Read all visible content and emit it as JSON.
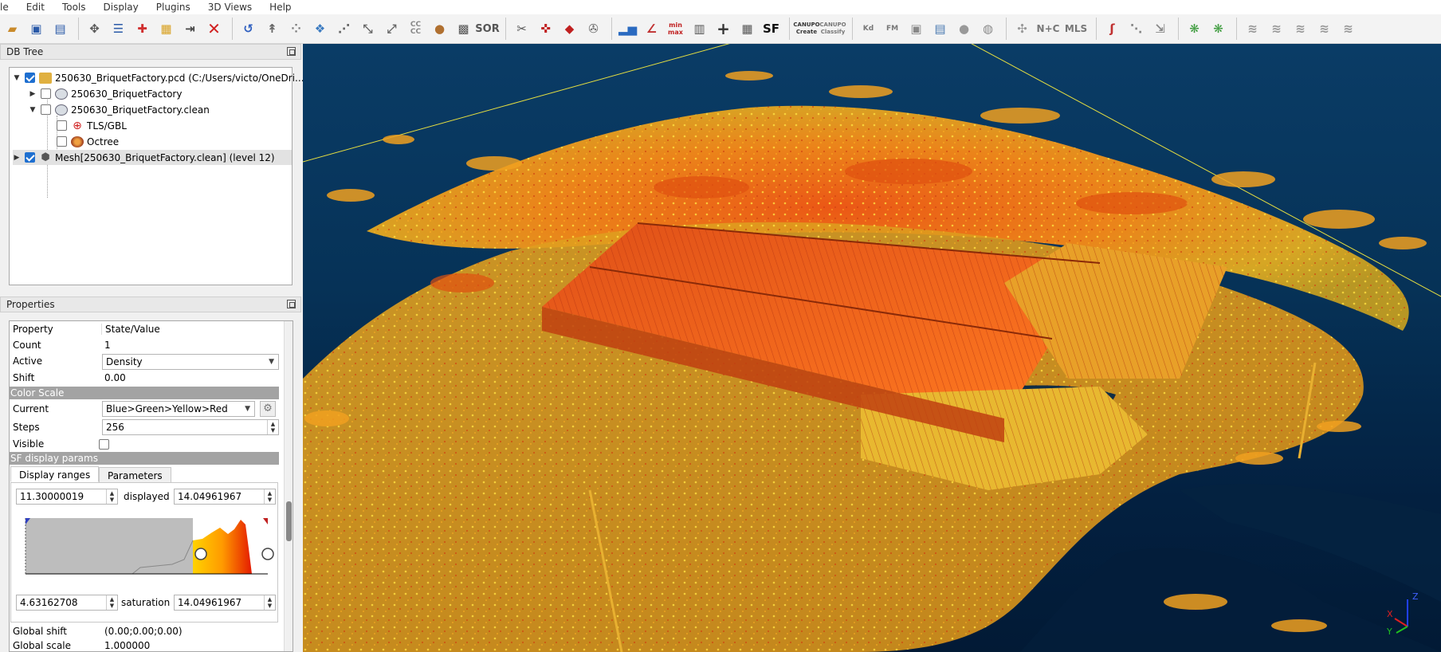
{
  "menu": [
    "le",
    "Edit",
    "Tools",
    "Display",
    "Plugins",
    "3D Views",
    "Help"
  ],
  "toolbar": {
    "sor_label": "SOR",
    "cc_label": "CC\nCC",
    "sf_label": "SF",
    "canupo_create": "CANUPO\nCreate",
    "canupo_classify": "CANUPO\nClassify",
    "kd_label": "Kd",
    "fm_label": "FM",
    "nc_label": "N+C",
    "mls_label": "MLS",
    "mm_label": "min\nmax"
  },
  "dbtree": {
    "title": "DB Tree",
    "items": [
      {
        "label": "250630_BriquetFactory.pcd (C:/Users/victo/OneDri...",
        "checked": true,
        "icon": "folder-icon"
      },
      {
        "label": "250630_BriquetFactory",
        "checked": false,
        "icon": "cloud-icon"
      },
      {
        "label": "250630_BriquetFactory.clean",
        "checked": false,
        "icon": "cloud-icon"
      },
      {
        "label": "TLS/GBL",
        "checked": false,
        "icon": "sensor-icon"
      },
      {
        "label": "Octree",
        "checked": false,
        "icon": "octree-icon"
      },
      {
        "label": "Mesh[250630_BriquetFactory.clean] (level 12)",
        "checked": true,
        "icon": "mesh-icon"
      }
    ]
  },
  "properties": {
    "title": "Properties",
    "header_property": "Property",
    "header_value": "State/Value",
    "count_label": "Count",
    "count_value": "1",
    "active_label": "Active",
    "active_value": "Density",
    "shift_label": "Shift",
    "shift_value": "0.00",
    "color_scale_section": "Color Scale",
    "current_label": "Current",
    "current_value": "Blue>Green>Yellow>Red",
    "steps_label": "Steps",
    "steps_value": "256",
    "visible_label": "Visible",
    "visible_checked": false,
    "sf_section": "SF display params",
    "tab_display_ranges": "Display ranges",
    "tab_parameters": "Parameters",
    "range_min": "11.30000019",
    "displayed_label": "displayed",
    "displayed_value": "14.04961967",
    "sat_min": "4.63162708",
    "saturation_label": "saturation",
    "saturation_value": "14.04961967",
    "global_shift_label": "Global shift",
    "global_shift_value": "(0.00;0.00;0.00)",
    "global_scale_label": "Global scale",
    "global_scale_value": "1.000000"
  },
  "axis": {
    "x": "X",
    "y": "Y",
    "z": "Z"
  },
  "colors": {
    "background_top": "#0a3c66",
    "background_bottom": "#021a35",
    "accent": "#1e6fd0"
  }
}
